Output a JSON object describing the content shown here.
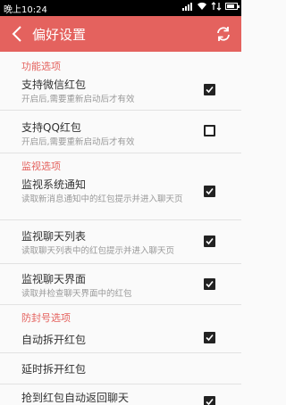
{
  "status_bar": {
    "time": "晚上10:24"
  },
  "app_bar": {
    "title": "偏好设置"
  },
  "sections": {
    "function": "功能选项",
    "monitor": "监视选项",
    "anti_ban": "防封号选项"
  },
  "items": [
    {
      "title": "支持微信红包",
      "subtitle": "开启后,需要重新启动后才有效",
      "checked": true
    },
    {
      "title": "支持QQ红包",
      "subtitle": "开启后,需要重新启动后才有效",
      "checked": false
    },
    {
      "title": "监视系统通知",
      "subtitle": "读取新消息通知中的红包提示并进入聊天页",
      "checked": true
    },
    {
      "title": "监视聊天列表",
      "subtitle": "读取聊天列表中的红包提示并进入聊天页",
      "checked": true
    },
    {
      "title": "监视聊天界面",
      "subtitle": "读取并检查聊天界面中的红包",
      "checked": true
    },
    {
      "title": "自动拆开红包",
      "subtitle": "",
      "checked": true
    },
    {
      "title": "延时拆开红包",
      "subtitle": "",
      "checked": null
    },
    {
      "title": "抢到红包自动返回聊天",
      "subtitle": "",
      "checked": true
    }
  ]
}
